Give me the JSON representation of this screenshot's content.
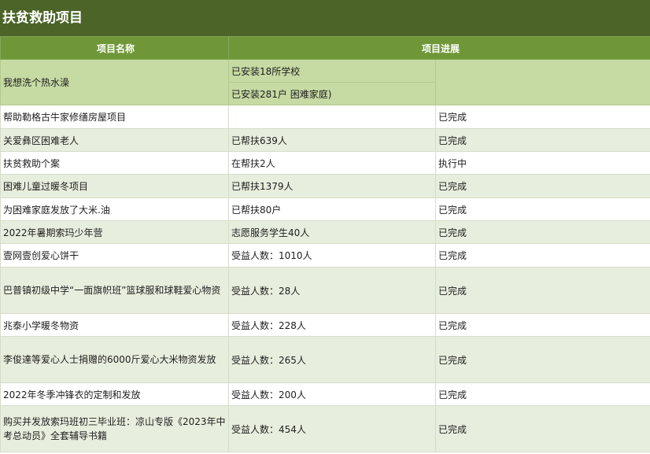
{
  "title": "扶贫救助项目",
  "headers": {
    "name": "项目名称",
    "progress": "项目进展"
  },
  "first_row": {
    "name": "我想洗个热水澡",
    "progress_lines": [
      "已安装18所学校",
      "已安装281户 困难家庭)"
    ]
  },
  "rows": [
    {
      "name": "帮助勒格古牛家修缮房屋项目",
      "progress": "",
      "status": "已完成"
    },
    {
      "name": "关爱彝区困难老人",
      "progress": "已帮扶639人",
      "status": "已完成"
    },
    {
      "name": "扶贫救助个案",
      "progress": "在帮扶2人",
      "status": "执行中"
    },
    {
      "name": "困难儿童过暖冬项目",
      "progress": "已帮扶1379人",
      "status": "已完成"
    },
    {
      "name": "为困难家庭发放了大米.油",
      "progress": "已帮扶80户",
      "status": "已完成"
    },
    {
      "name": "2022年暑期索玛少年营",
      "progress": "志愿服务学生40人",
      "status": "已完成"
    },
    {
      "name": "壹网壹创爱心饼干",
      "progress": "受益人数：1010人",
      "status": "已完成"
    },
    {
      "name": "巴普镇初级中学“一面旗帜班”篮球服和球鞋爱心物资",
      "progress": "受益人数：28人",
      "status": "已完成"
    },
    {
      "name": "兆泰小学暖冬物资",
      "progress": "受益人数：228人",
      "status": "已完成"
    },
    {
      "name": "李俊達等爱心人士捐赠的6000斤爱心大米物资发放",
      "progress": "受益人数：265人",
      "status": "已完成"
    },
    {
      "name": "2022年冬季冲锋衣的定制和发放",
      "progress": "受益人数：200人",
      "status": "已完成"
    },
    {
      "name": "购买并发放索玛班初三毕业班：凉山专版《2023年中考总动员》全套辅导书籍",
      "progress": "受益人数：454人",
      "status": "已完成"
    }
  ],
  "colors": {
    "title_bg": "#4c6428",
    "header_bg": "#6f9738",
    "light_row_bg": "#c6daa3",
    "alt_row_bg": "#e8eedd"
  }
}
